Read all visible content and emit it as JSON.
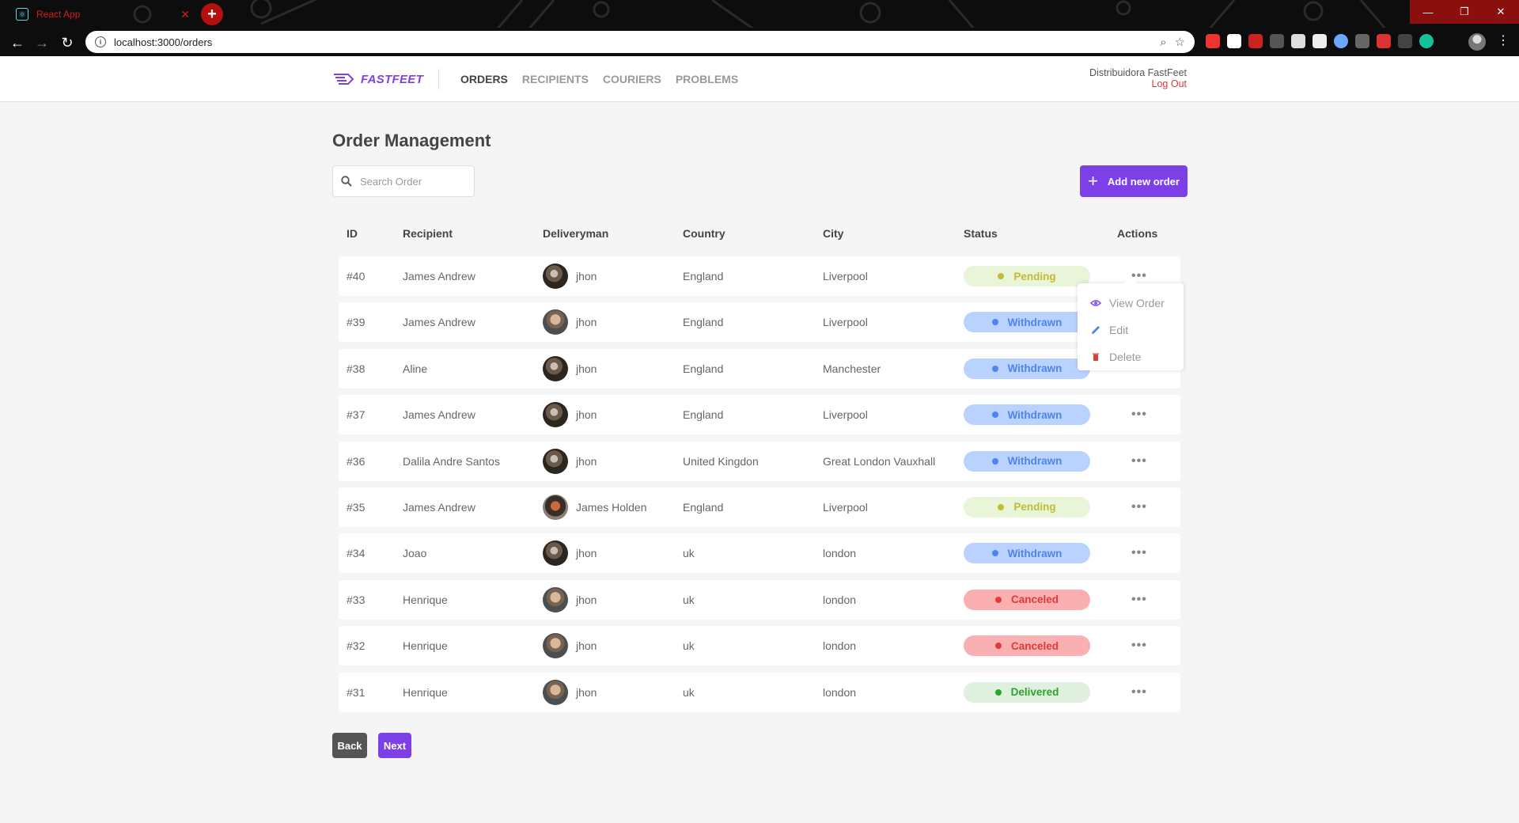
{
  "browser": {
    "tab_title": "React App",
    "url": "localhost:3000/orders"
  },
  "header": {
    "brand": "FASTFEET",
    "nav": [
      "ORDERS",
      "RECIPIENTS",
      "COURIERS",
      "PROBLEMS"
    ],
    "active_nav": "ORDERS",
    "user_name": "Distribuidora FastFeet",
    "logout": "Log Out"
  },
  "page": {
    "title": "Order Management",
    "search_placeholder": "Search Order",
    "add_button": "Add new order"
  },
  "table": {
    "columns": [
      "ID",
      "Recipient",
      "Deliveryman",
      "Country",
      "City",
      "Status",
      "Actions"
    ],
    "rows": [
      {
        "id": "#40",
        "recipient": "James Andrew",
        "deliveryman": "jhon",
        "avatar": "dark",
        "country": "England",
        "city": "Liverpool",
        "status": "Pending"
      },
      {
        "id": "#39",
        "recipient": "James Andrew",
        "deliveryman": "jhon",
        "avatar": "face",
        "country": "England",
        "city": "Liverpool",
        "status": "Withdrawn"
      },
      {
        "id": "#38",
        "recipient": "Aline",
        "deliveryman": "jhon",
        "avatar": "dark",
        "country": "England",
        "city": "Manchester",
        "status": "Withdrawn"
      },
      {
        "id": "#37",
        "recipient": "James Andrew",
        "deliveryman": "jhon",
        "avatar": "dark",
        "country": "England",
        "city": "Liverpool",
        "status": "Withdrawn"
      },
      {
        "id": "#36",
        "recipient": "Dalila Andre Santos",
        "deliveryman": "jhon",
        "avatar": "dark",
        "country": "United Kingdon",
        "city": "Great London Vauxhall",
        "status": "Withdrawn"
      },
      {
        "id": "#35",
        "recipient": "James Andrew",
        "deliveryman": "James Holden",
        "avatar": "helmet",
        "country": "England",
        "city": "Liverpool",
        "status": "Pending"
      },
      {
        "id": "#34",
        "recipient": "Joao",
        "deliveryman": "jhon",
        "avatar": "dark",
        "country": "uk",
        "city": "london",
        "status": "Withdrawn"
      },
      {
        "id": "#33",
        "recipient": "Henrique",
        "deliveryman": "jhon",
        "avatar": "face",
        "country": "uk",
        "city": "london",
        "status": "Canceled"
      },
      {
        "id": "#32",
        "recipient": "Henrique",
        "deliveryman": "jhon",
        "avatar": "face",
        "country": "uk",
        "city": "london",
        "status": "Canceled"
      },
      {
        "id": "#31",
        "recipient": "Henrique",
        "deliveryman": "jhon",
        "avatar": "face",
        "country": "uk",
        "city": "london",
        "status": "Delivered"
      }
    ],
    "actions_glyph": "•••"
  },
  "dropdown": {
    "items": [
      "View Order",
      "Edit",
      "Delete"
    ]
  },
  "pagination": {
    "back": "Back",
    "next": "Next"
  },
  "colors": {
    "brand": "#7d40e7",
    "pending": "#c1bc35",
    "withdrawn": "#4d85ee",
    "canceled": "#de3b3b",
    "delivered": "#2ca42b"
  }
}
